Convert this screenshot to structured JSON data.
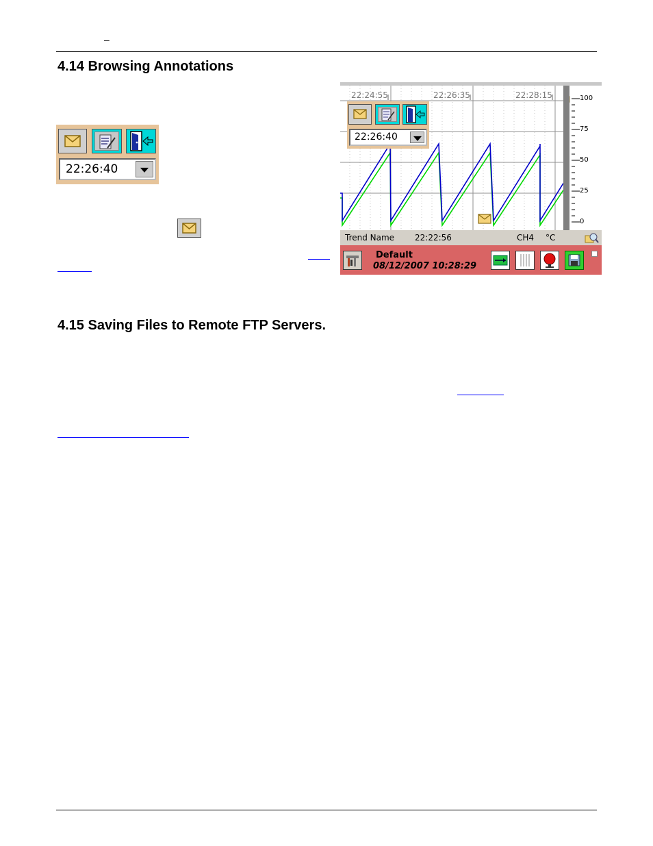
{
  "header": {
    "mark": "–"
  },
  "section_414": {
    "heading": "4.14  Browsing Annotations"
  },
  "toolbar_left": {
    "time_value": "22:26:40"
  },
  "recorder": {
    "ticks_top": [
      "22:24:55",
      "22:26:35",
      "22:28:15"
    ],
    "scale": [
      "100",
      "75",
      "50",
      "25",
      "0"
    ],
    "toolbar_time": "22:26:40",
    "status": {
      "trend_name": "Trend Name",
      "time": "22:22:56",
      "channel": "CH4",
      "unit": "°C"
    },
    "bottom": {
      "name": "Default",
      "datetime": "08/12/2007 10:28:29"
    },
    "colors": {
      "blue_series": "#0000c8",
      "green_series": "#00d800",
      "bottom_bar": "#d96464",
      "toolbar_bg": "#e6c49a"
    }
  },
  "section_415": {
    "heading": "4.15  Saving Files to Remote FTP Servers."
  }
}
